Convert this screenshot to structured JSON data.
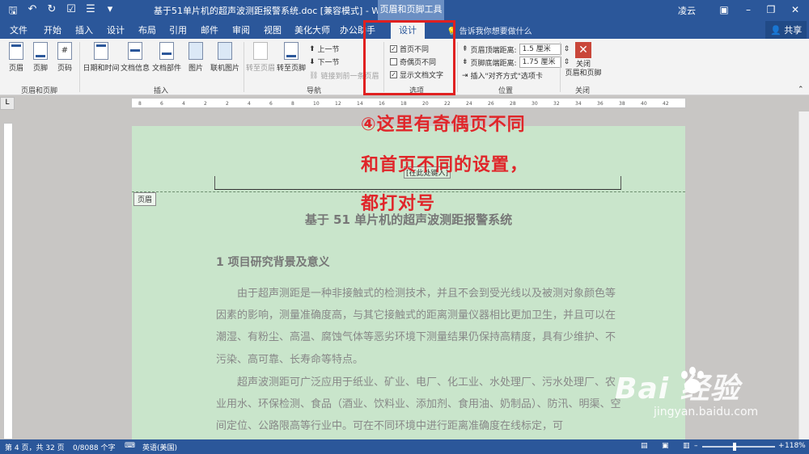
{
  "titlebar": {
    "doc_title": "基于51单片机的超声波测距报警系统.doc [兼容模式] - Word",
    "context_header": "页眉和页脚工具",
    "user": "凌云",
    "qat_icons": [
      "save-icon",
      "undo-icon",
      "redo-icon",
      "checkbox-icon",
      "list-icon",
      "customize-icon"
    ]
  },
  "tabs": [
    {
      "label": "文件"
    },
    {
      "label": "开始"
    },
    {
      "label": "插入"
    },
    {
      "label": "设计"
    },
    {
      "label": "布局"
    },
    {
      "label": "引用"
    },
    {
      "label": "邮件"
    },
    {
      "label": "审阅"
    },
    {
      "label": "视图"
    },
    {
      "label": "美化大师"
    },
    {
      "label": "办公助手"
    }
  ],
  "active_tab": "设计",
  "tell_me": "告诉我你想要做什么",
  "share": "共享",
  "ribbon": {
    "hf_group": {
      "label": "页眉和页脚",
      "buttons": [
        "页眉",
        "页脚",
        "页码"
      ]
    },
    "insert_group": {
      "label": "插入",
      "buttons": [
        "日期和时间",
        "文档信息",
        "文档部件",
        "图片",
        "联机图片"
      ]
    },
    "nav_group": {
      "label": "导航",
      "goto_header": "转至页眉",
      "goto_footer": "转至页脚",
      "prev": "上一节",
      "next": "下一节",
      "link_prev": "链接到前一条页眉"
    },
    "options_group": {
      "label": "选项",
      "diff_first": {
        "label": "首页不同",
        "checked": "✓"
      },
      "diff_odd_even": {
        "label": "奇偶页不同",
        "checked": ""
      },
      "show_doc_text": {
        "label": "显示文档文字",
        "checked": "✓"
      }
    },
    "position_group": {
      "label": "位置",
      "header_top_label": "页眉顶端距离:",
      "header_top_value": "1.5 厘米",
      "footer_bottom_label": "页脚底端距离:",
      "footer_bottom_value": "1.75 厘米",
      "insert_align": "插入\"对齐方式\"选项卡"
    },
    "close_group": {
      "label": "关闭",
      "button": "关闭\n页眉和页脚"
    }
  },
  "ruler": {
    "corner": "L",
    "ticks": [
      "8",
      "6",
      "4",
      "2",
      "2",
      "4",
      "6",
      "8",
      "10",
      "12",
      "14",
      "16",
      "18",
      "20",
      "22",
      "24",
      "26",
      "28",
      "30",
      "32",
      "34",
      "36",
      "38",
      "40",
      "42"
    ]
  },
  "document": {
    "header_placeholder": "[在此处键入]",
    "header_label": "页眉",
    "heading": "基于 51 单片机的超声波测距报警系统",
    "section_title": "1  项目研究背景及意义",
    "para1": "由于超声测距是一种非接触式的检测技术，并且不会到受光线以及被测对象颜色等因素的影响，测量准确度高，与其它接触式的距离测量仪器相比更加卫生，并且可以在潮湿、有粉尘、高温、腐蚀气体等恶劣环境下测量结果仍保持高精度，具有少维护、不污染、高可靠、长寿命等特点。",
    "para2": "超声波测距可广泛应用于纸业、矿业、电厂、化工业、水处理厂、污水处理厂、农业用水、环保检测、食品（酒业、饮料业、添加剂、食用油、奶制品）、防汛、明渠、空间定位、公路限高等行业中。可在不同环境中进行距离准确度在线标定，可"
  },
  "annotation": {
    "line1": "④这里有奇偶页不同",
    "line2": "和首页不同的设置，",
    "line3": "都打对号",
    "color": "#e0262a"
  },
  "status": {
    "page": "第 4 页，共 32 页",
    "words": "0/8088 个字",
    "lang": "英语(美国)",
    "zoom": "118%"
  },
  "watermark": {
    "brand": "Bai  经验",
    "site": "jingyan.baidu.com"
  },
  "colors": {
    "word_blue": "#2b579a",
    "page_green": "#c9e5cb",
    "highlight_red": "#e02020"
  }
}
